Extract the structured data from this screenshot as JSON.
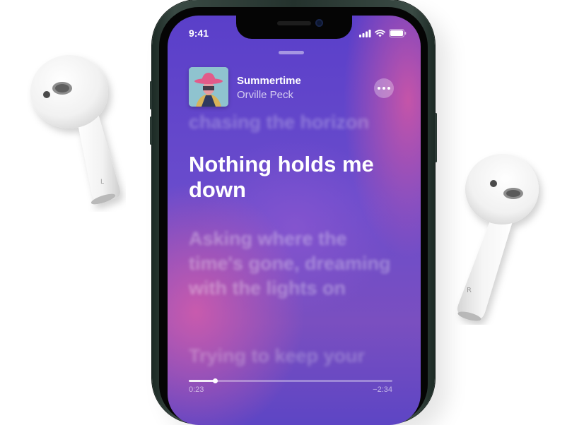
{
  "status_bar": {
    "time": "9:41"
  },
  "now_playing": {
    "title": "Summertime",
    "artist": "Orville Peck",
    "artwork_icon": "album-artwork"
  },
  "lyrics": {
    "previous": "chasing the horizon",
    "current": "Nothing holds me down",
    "next": "Asking where the time's gone, dreaming with the lights on",
    "after_next": "Trying to keep your"
  },
  "playback": {
    "elapsed": "0:23",
    "remaining": "−2:34",
    "progress_fraction": 0.13
  },
  "airpods": {
    "left_label": "L",
    "right_label": "R"
  },
  "colors": {
    "accent": "#6a4ccc",
    "highlight": "#d65caa"
  }
}
